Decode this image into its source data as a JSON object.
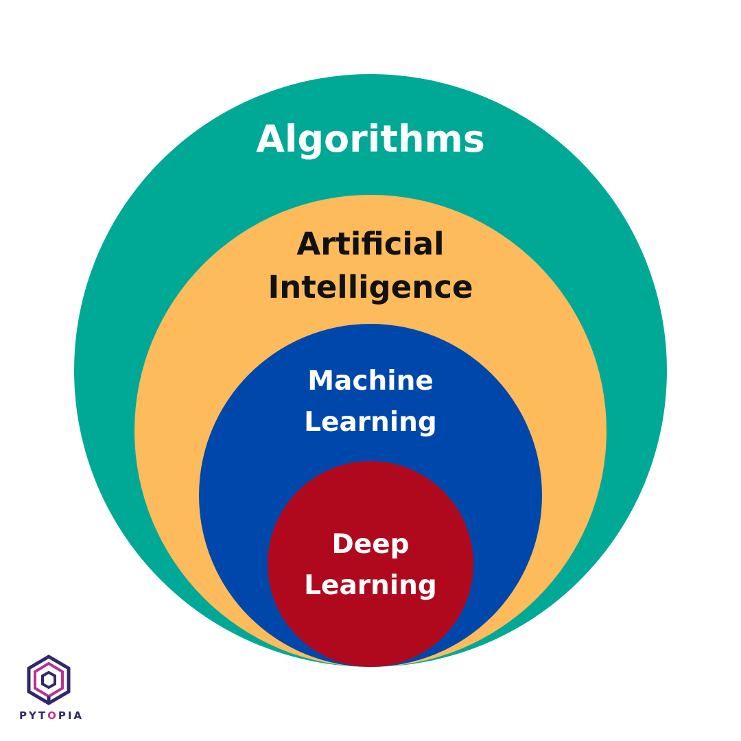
{
  "diagram": {
    "layers": [
      {
        "key": "algorithms",
        "label_lines": [
          "Algorithms"
        ],
        "color": "#00A896",
        "text_color": "#ffffff"
      },
      {
        "key": "ai",
        "label_lines": [
          "Artificial",
          "Intelligence"
        ],
        "color": "#FDBB5C",
        "text_color": "#111111"
      },
      {
        "key": "ml",
        "label_lines": [
          "Machine",
          "Learning"
        ],
        "color": "#0047AB",
        "text_color": "#ffffff"
      },
      {
        "key": "dl",
        "label_lines": [
          "Deep",
          "Learning"
        ],
        "color": "#B0091E",
        "text_color": "#ffffff"
      }
    ]
  },
  "logo": {
    "text_part1": "PYT",
    "text_part2": "O",
    "text_part3": "PIA",
    "colors": {
      "primary": "#2e2a6a",
      "accent": "#b8338f"
    }
  }
}
